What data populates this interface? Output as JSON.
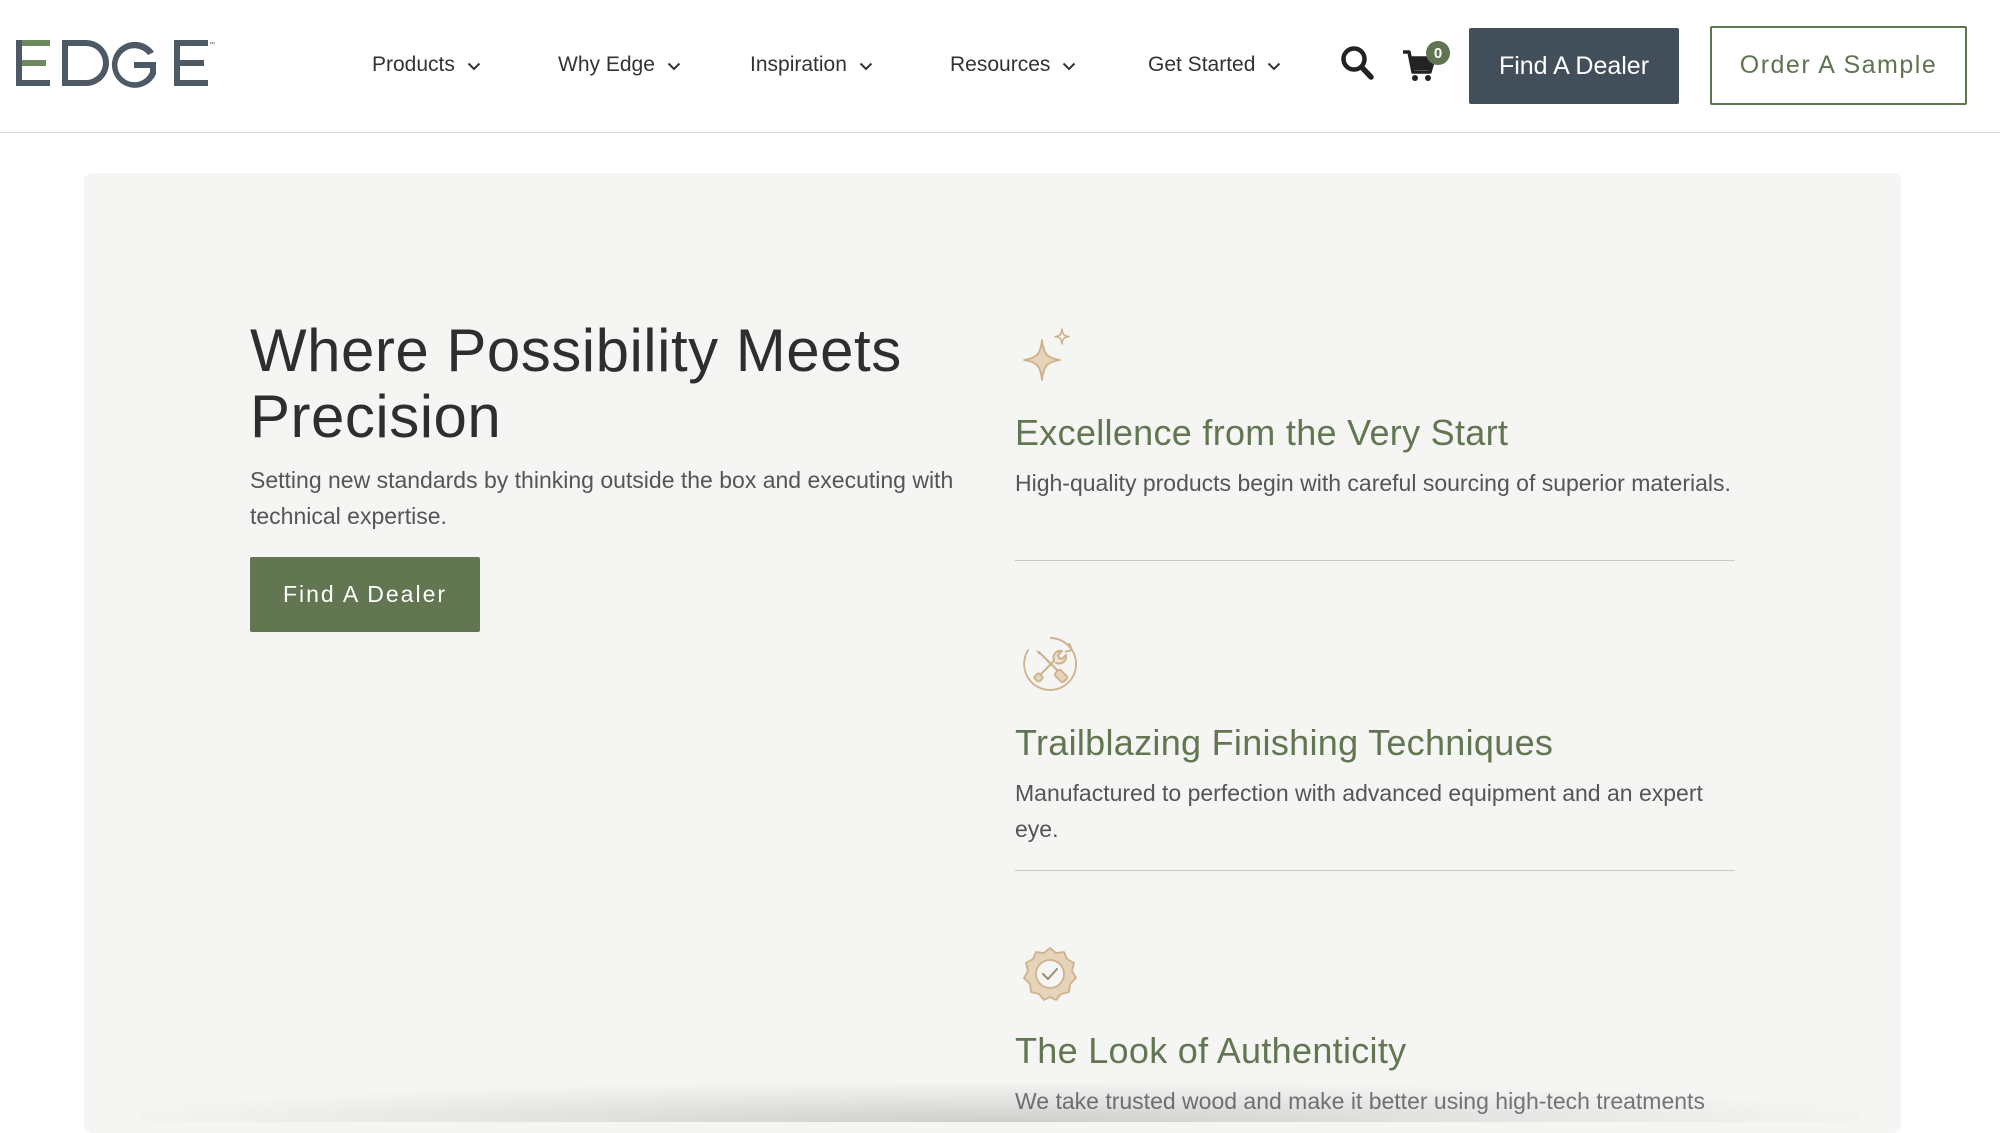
{
  "header": {
    "logo_text": "EDGE",
    "nav": [
      {
        "label": "Products"
      },
      {
        "label": "Why Edge"
      },
      {
        "label": "Inspiration"
      },
      {
        "label": "Resources"
      },
      {
        "label": "Get Started"
      }
    ],
    "cart_count": "0",
    "find_dealer_label": "Find A Dealer",
    "order_sample_label": "Order A Sample"
  },
  "hero": {
    "title": "Where Possibility Meets Precision",
    "subtitle": "Setting new standards by thinking outside the box and executing with technical expertise.",
    "button_label": "Find A Dealer"
  },
  "features": [
    {
      "icon": "sparkle-icon",
      "title": "Excellence from the Very Start",
      "text": "High-quality products begin with careful sourcing of superior materials."
    },
    {
      "icon": "tools-icon",
      "title": "Trailblazing Finishing Techniques",
      "text": "Manufactured to perfection with advanced equipment and an expert eye."
    },
    {
      "icon": "badge-check-icon",
      "title": "The Look of Authenticity",
      "text": "We take trusted wood and make it better using high-tech treatments"
    }
  ],
  "colors": {
    "brand_green": "#627652",
    "slate": "#434e5b",
    "icon_tan": "#cfb28c",
    "panel_bg": "#f5f5f3"
  }
}
